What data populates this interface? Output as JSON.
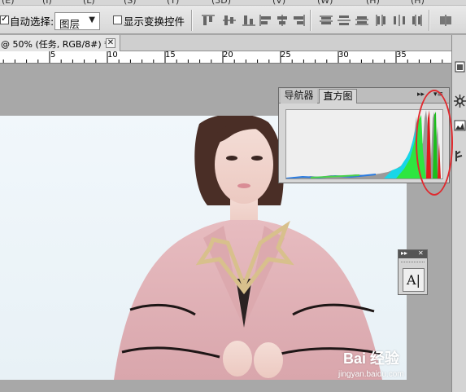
{
  "options_bar": {
    "auto_select_label": "自动选择:",
    "auto_select_checked": true,
    "layer_select_value": "图层",
    "show_transform_label": "显示变换控件",
    "show_transform_checked": false,
    "align_icons": [
      "align-top-icon",
      "align-vcenter-icon",
      "align-bottom-icon",
      "align-left-icon",
      "align-hcenter-icon",
      "align-right-icon"
    ],
    "distribute_icons": [
      "distribute-top-icon",
      "distribute-vcenter-icon",
      "distribute-bottom-icon",
      "distribute-left-icon",
      "distribute-hcenter-icon",
      "distribute-right-icon"
    ],
    "auto_align_icon": "auto-align-icon"
  },
  "document_tab": {
    "title": "@ 50% (任务, RGB/8#) *",
    "close_label": "✕"
  },
  "ruler": {
    "labels": [
      "5",
      "10",
      "15",
      "20",
      "25",
      "30",
      "35"
    ]
  },
  "histogram_panel": {
    "tabs": [
      "导航器",
      "直方图"
    ],
    "active_tab": "直方图",
    "expand_label": "▸▸",
    "menu_label": "▾≡"
  },
  "character_panel": {
    "expand_label": "▸▸",
    "close_label": "✕",
    "button_label": "A|"
  },
  "watermark": {
    "main_text": "Bai 经验",
    "sub_text": "jingyan.baidu.com"
  },
  "colors": {
    "annotation_red": "#e0282d",
    "panel_bg": "#d6d6d6",
    "canvas_bg": "#a8a8a8"
  }
}
